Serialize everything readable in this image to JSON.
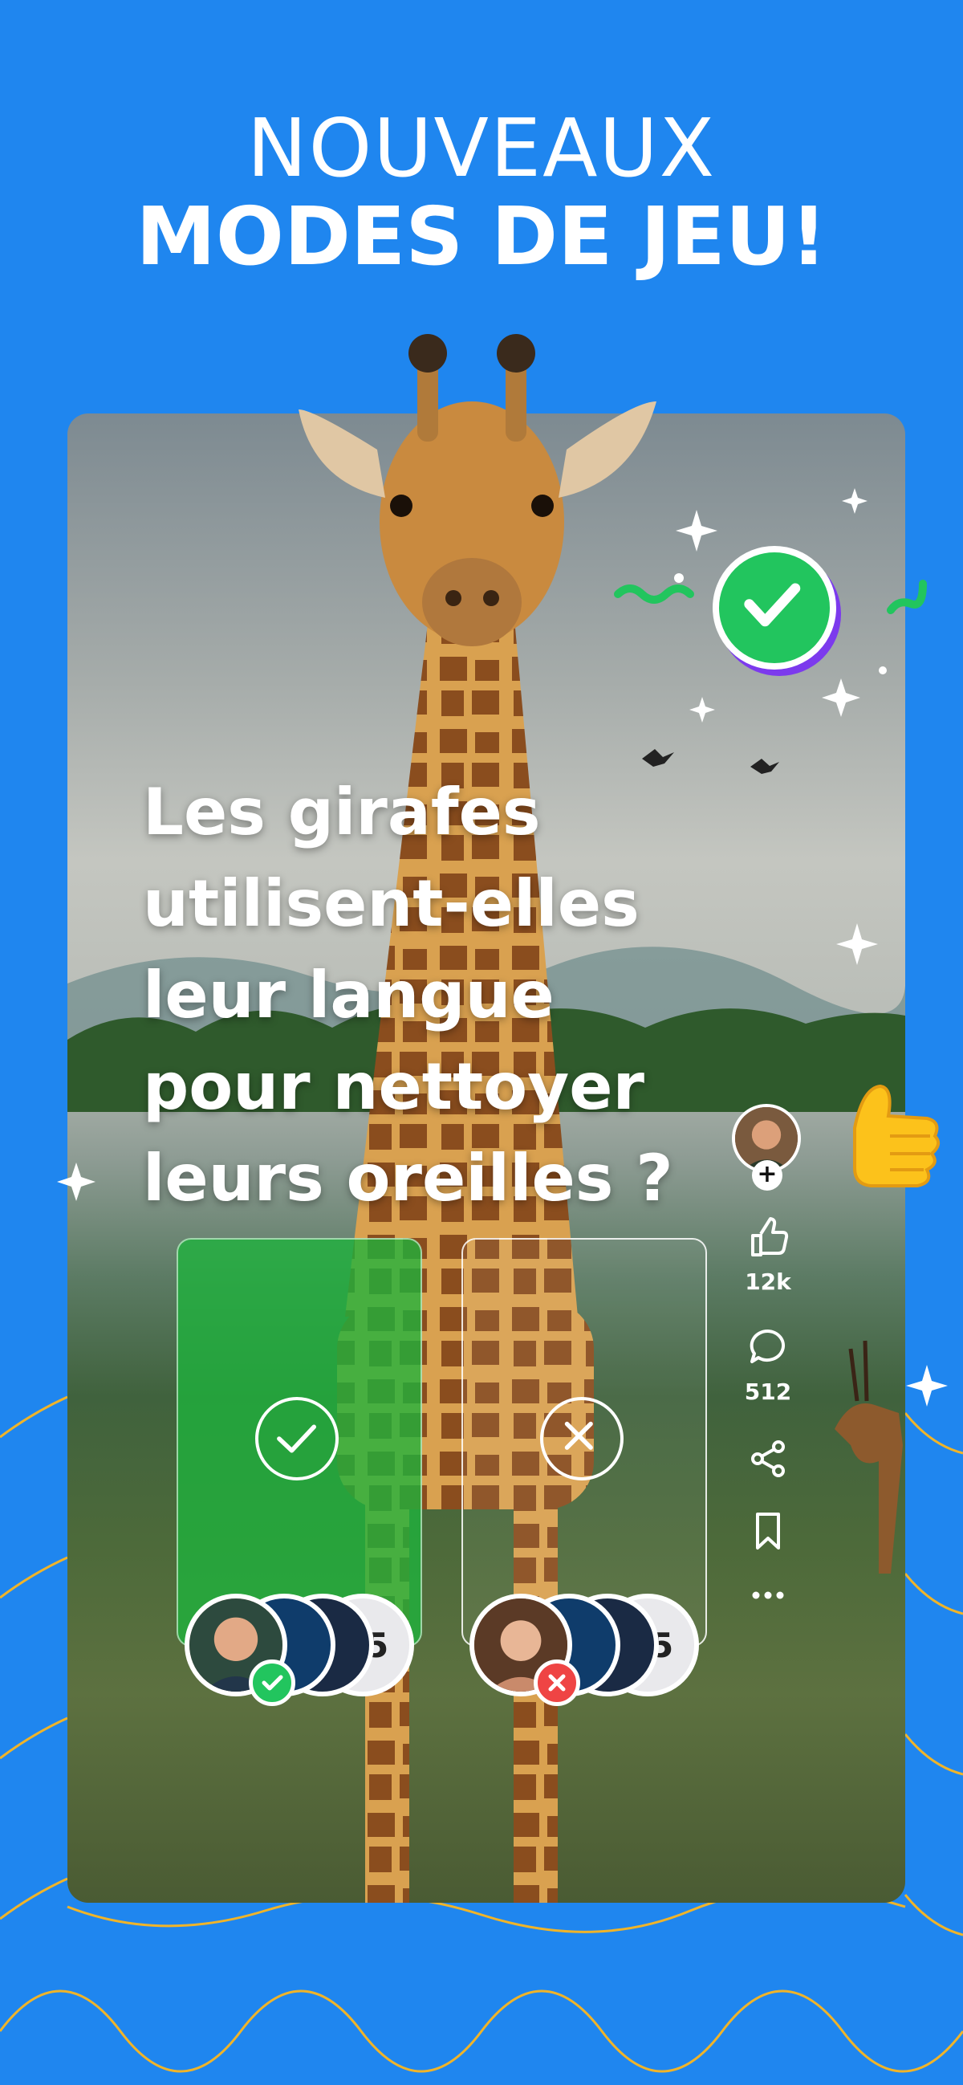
{
  "header": {
    "line1": "NOUVEAUX",
    "line2": "MODES DE JEU!"
  },
  "question": {
    "line1": "Les girafes",
    "line2": "utilisent-elles",
    "line3": "leur langue",
    "line4": "pour nettoyer",
    "line5": "leurs oreilles ?"
  },
  "answers": {
    "yes_icon": "check-circle-icon",
    "no_icon": "x-circle-icon",
    "yes_more_count": "+5",
    "no_more_count": "+5"
  },
  "actions": {
    "likes": "12k",
    "comments": "512"
  },
  "colors": {
    "background": "#1f86ef",
    "correct_green": "#22c55e",
    "wrong_red": "#ef4444",
    "accent_purple": "#7c3aed",
    "wave_gold": "#f0b429"
  }
}
